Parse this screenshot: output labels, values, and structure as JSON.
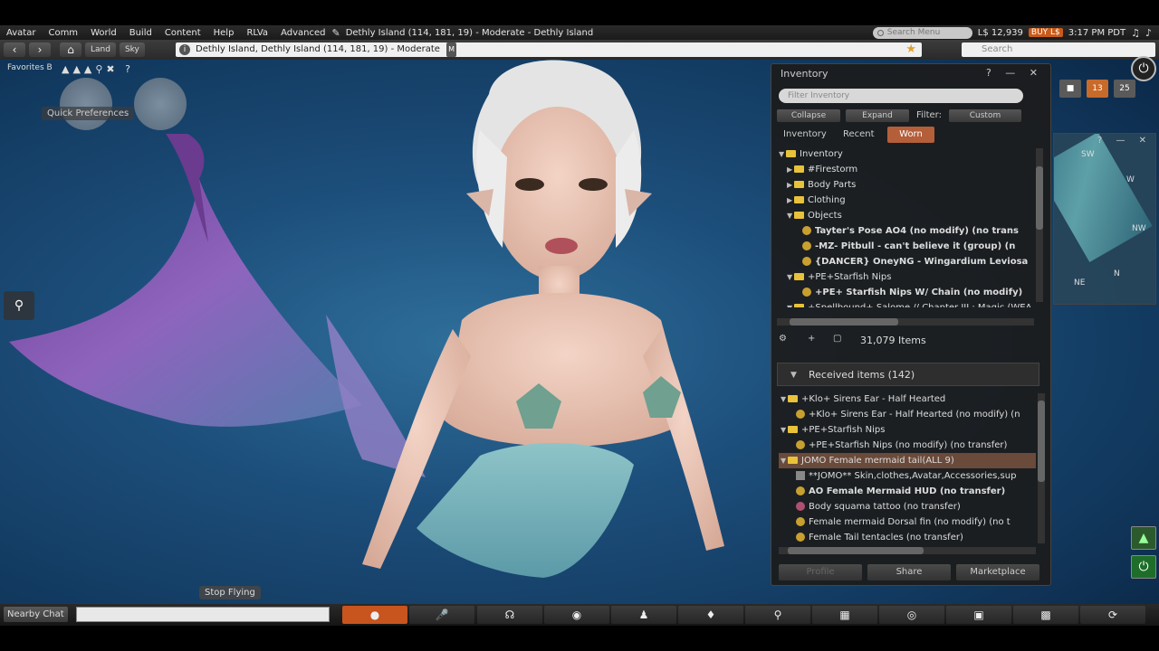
{
  "menubar": {
    "items": [
      "Avatar",
      "Comm",
      "World",
      "Build",
      "Content",
      "Help",
      "RLVa",
      "Advanced"
    ],
    "region_title": "Dethly Island (114, 181, 19) - Moderate - Dethly Island",
    "search_placeholder": "Search Menu",
    "balance": "L$ 12,939",
    "buy_label": "BUY L$",
    "clock": "3:17 PM PDT"
  },
  "navbar": {
    "land_label": "Land",
    "sky_label": "Sky",
    "location": "Dethly Island, Dethly Island (114, 181, 19) - Moderate",
    "moderate_badge": "M",
    "search_placeholder": "Search"
  },
  "favorites_label": "Favorites B",
  "quick_prefs": "Quick Preferences",
  "stop_flying": "Stop Flying",
  "nearby_chat": "Nearby Chat",
  "inventory": {
    "title": "Inventory",
    "filter_placeholder": "Filter Inventory",
    "collapse": "Collapse",
    "expand": "Expand",
    "filter_label": "Filter:",
    "filter_value": "Custom",
    "tabs": [
      "Inventory",
      "Recent",
      "Worn"
    ],
    "active_tab": "Worn",
    "tree": [
      {
        "depth": 0,
        "tri": "▼",
        "icon": "folder",
        "text": "Inventory",
        "bold": false
      },
      {
        "depth": 1,
        "tri": "▶",
        "icon": "folder",
        "text": "#Firestorm",
        "bold": false
      },
      {
        "depth": 1,
        "tri": "▶",
        "icon": "folder",
        "text": "Body Parts",
        "bold": false
      },
      {
        "depth": 1,
        "tri": "▶",
        "icon": "folder",
        "text": "Clothing",
        "bold": false
      },
      {
        "depth": 1,
        "tri": "▼",
        "icon": "folder",
        "text": "Objects",
        "bold": false
      },
      {
        "depth": 2,
        "tri": "",
        "icon": "obj",
        "text": "Tayter's Pose AO4 (no modify) (no trans",
        "bold": true
      },
      {
        "depth": 2,
        "tri": "",
        "icon": "obj",
        "text": "-MZ- Pitbull -  can't believe it (group) (n",
        "bold": true
      },
      {
        "depth": 2,
        "tri": "",
        "icon": "obj",
        "text": "{DANCER} OneyNG - Wingardium Leviosa",
        "bold": true
      },
      {
        "depth": 1,
        "tri": "▼",
        "icon": "folder",
        "text": "+PE+Starfish Nips",
        "bold": false
      },
      {
        "depth": 2,
        "tri": "",
        "icon": "obj",
        "text": "+PE+ Starfish Nips W/ Chain (no modify)",
        "bold": true
      },
      {
        "depth": 1,
        "tri": "▼",
        "icon": "folder",
        "text": "+Spellbound+ Salome // Chapter III : Magic (WEA",
        "bold": false
      }
    ],
    "item_count": "31,079 Items",
    "received_header": "Received items (142)",
    "received": [
      {
        "depth": 0,
        "tri": "▼",
        "icon": "folder",
        "text": "+Klo+ Sirens Ear - Half Hearted",
        "bold": false,
        "selected": false
      },
      {
        "depth": 1,
        "tri": "",
        "icon": "obj",
        "text": "+Klo+ Sirens Ear - Half Hearted (no modify) (n",
        "bold": false,
        "selected": false
      },
      {
        "depth": 0,
        "tri": "▼",
        "icon": "folder",
        "text": "+PE+Starfish Nips",
        "bold": false,
        "selected": false
      },
      {
        "depth": 1,
        "tri": "",
        "icon": "obj",
        "text": "+PE+Starfish Nips (no modify) (no transfer)",
        "bold": false,
        "selected": false
      },
      {
        "depth": 0,
        "tri": "▼",
        "icon": "folder",
        "text": "JOMO Female mermaid tail(ALL 9)",
        "bold": false,
        "selected": true
      },
      {
        "depth": 1,
        "tri": "",
        "icon": "cloth",
        "text": "**JOMO** Skin,clothes,Avatar,Accessories,sup",
        "bold": false,
        "selected": false
      },
      {
        "depth": 1,
        "tri": "",
        "icon": "obj",
        "text": "AO Female Mermaid HUD (no transfer)",
        "bold": true,
        "selected": false
      },
      {
        "depth": 1,
        "tri": "",
        "icon": "tattoo",
        "text": "Body squama tattoo (no transfer)",
        "bold": false,
        "selected": false
      },
      {
        "depth": 1,
        "tri": "",
        "icon": "obj",
        "text": "Female mermaid Dorsal fin (no modify) (no t",
        "bold": false,
        "selected": false
      },
      {
        "depth": 1,
        "tri": "",
        "icon": "obj",
        "text": "Female Tail tentacles (no transfer)",
        "bold": false,
        "selected": false
      }
    ],
    "footer_profile": "Profile",
    "footer_share": "Share",
    "footer_marketplace": "Marketplace"
  },
  "minimap": {
    "n": "N",
    "ne": "NE",
    "nw": "NW",
    "w": "W",
    "sw": "SW"
  },
  "top_right_badges": {
    "b1": "13",
    "b2": "25"
  }
}
